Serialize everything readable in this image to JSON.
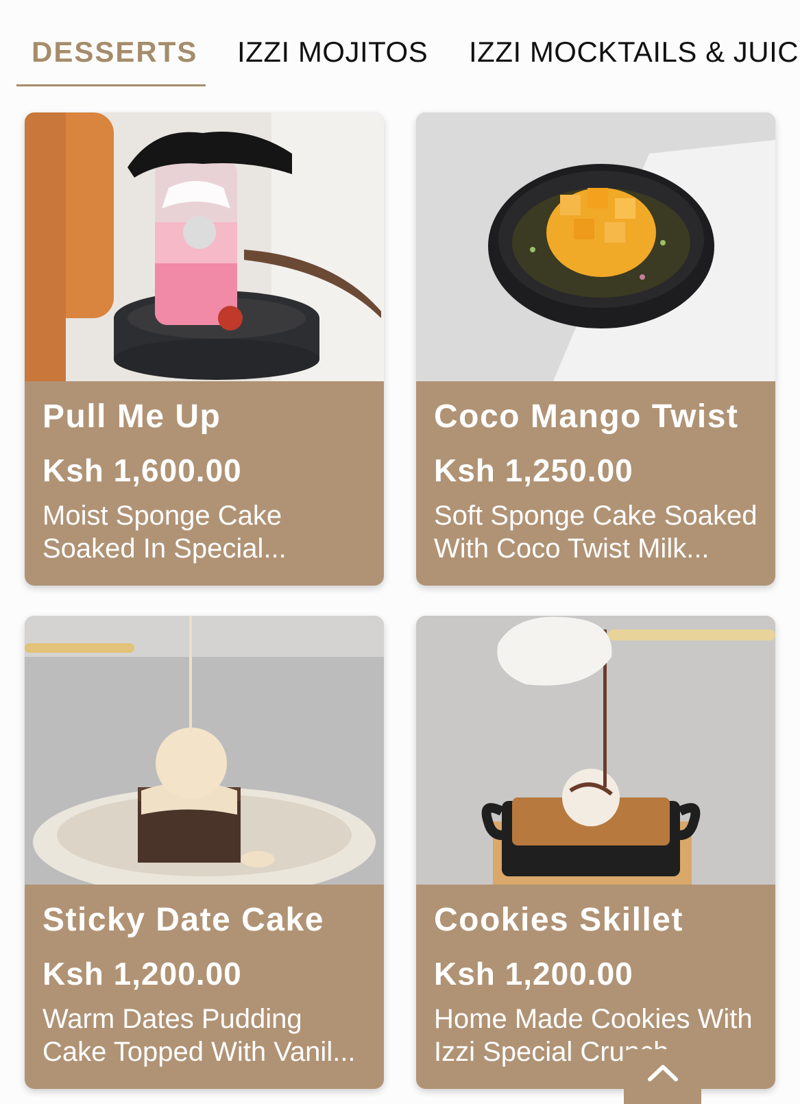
{
  "tabs": [
    {
      "label": "DESSERTS",
      "active": true
    },
    {
      "label": "IZZI MOJITOS",
      "active": false
    },
    {
      "label": "IZZI MOCKTAILS & JUICES",
      "active": false
    }
  ],
  "colors": {
    "accent": "#a58c6b",
    "card_background": "#b09375",
    "card_text": "#ffffff"
  },
  "items": [
    {
      "title": "Pull Me Up",
      "price": "Ksh 1,600.00",
      "description": "Moist Sponge Cake Soaked In Special..."
    },
    {
      "title": "Coco Mango Twist",
      "price": "Ksh 1,250.00",
      "description": "Soft Sponge Cake Soaked With Coco Twist Milk..."
    },
    {
      "title": "Sticky Date Cake",
      "price": "Ksh 1,200.00",
      "description": "Warm Dates Pudding Cake Topped With Vanil..."
    },
    {
      "title": "Cookies Skillet",
      "price": "Ksh 1,200.00",
      "description": "Home Made Cookies With Izzi Special Crunch..."
    }
  ],
  "scroll_top_icon": "chevron-up-icon"
}
